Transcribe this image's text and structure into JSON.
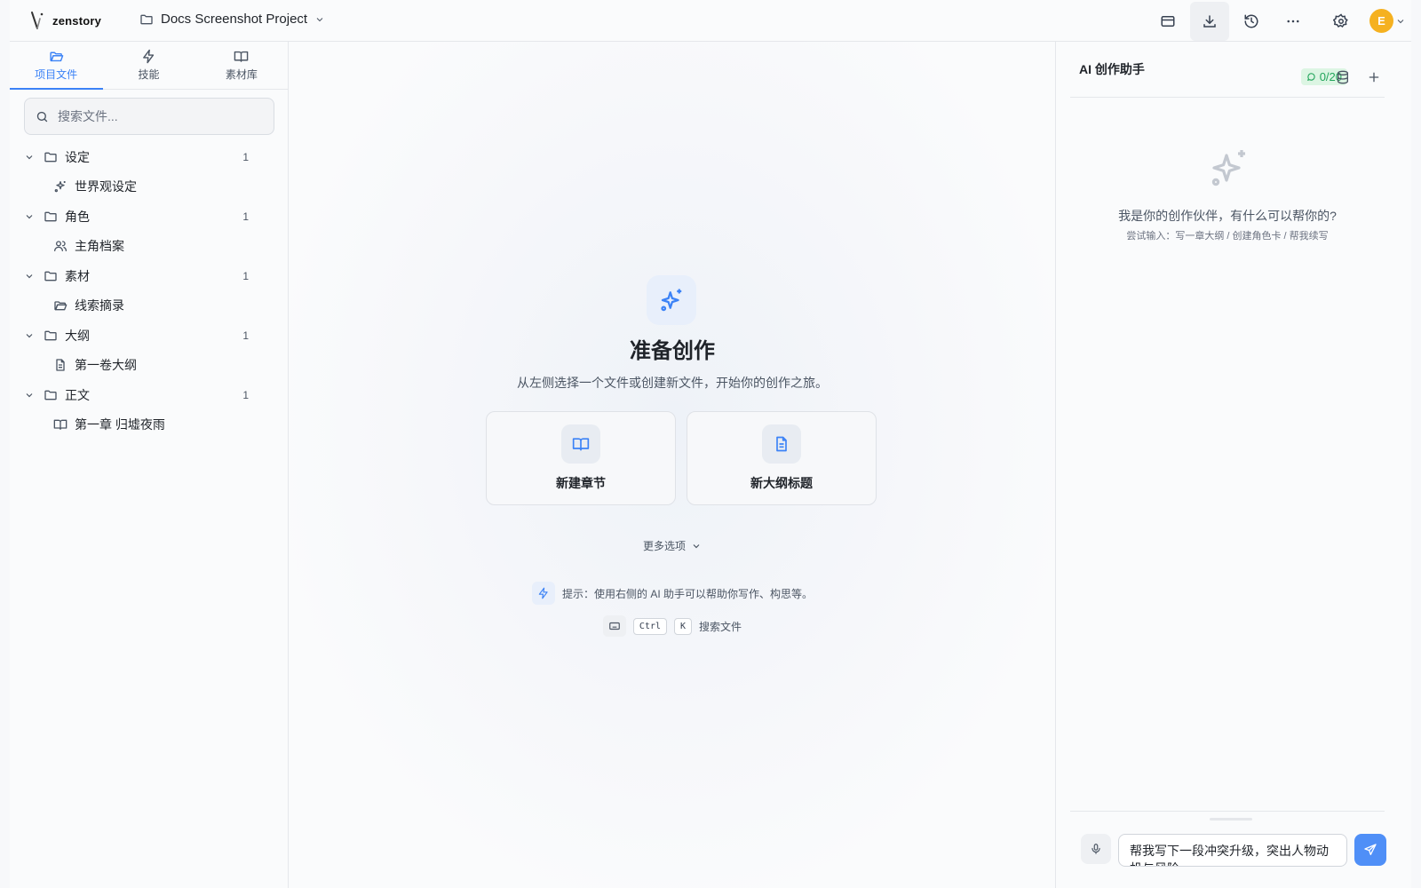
{
  "app": {
    "logo_text": "zenstory",
    "project_name": "Docs Screenshot Project"
  },
  "topbar": {
    "icons": [
      "window-icon",
      "download-icon",
      "history-icon",
      "more-icon",
      "settings-icon"
    ],
    "avatar_initial": "E"
  },
  "sidebar": {
    "tabs": [
      {
        "label": "项目文件",
        "icon": "folder-open-icon"
      },
      {
        "label": "技能",
        "icon": "lightning-icon"
      },
      {
        "label": "素材库",
        "icon": "book-icon"
      }
    ],
    "search_placeholder": "搜索文件...",
    "folders": [
      {
        "label": "设定",
        "count": "1",
        "files": [
          {
            "label": "世界观设定",
            "icon": "sparkle-icon"
          }
        ]
      },
      {
        "label": "角色",
        "count": "1",
        "files": [
          {
            "label": "主角档案",
            "icon": "users-icon"
          }
        ]
      },
      {
        "label": "素材",
        "count": "1",
        "files": [
          {
            "label": "线索摘录",
            "icon": "folder-open-icon"
          }
        ]
      },
      {
        "label": "大纲",
        "count": "1",
        "files": [
          {
            "label": "第一卷大纲",
            "icon": "document-icon"
          }
        ]
      },
      {
        "label": "正文",
        "count": "1",
        "files": [
          {
            "label": "第一章 归墟夜雨",
            "icon": "book-icon"
          }
        ]
      }
    ]
  },
  "main": {
    "title": "准备创作",
    "subtitle": "从左侧选择一个文件或创建新文件，开始你的创作之旅。",
    "cards": [
      {
        "label": "新建章节",
        "icon": "book-icon"
      },
      {
        "label": "新大纲标题",
        "icon": "document-icon"
      }
    ],
    "more_label": "更多选项",
    "tip": "提示：使用右侧的 AI 助手可以帮助你写作、构思等。",
    "shortcut": {
      "key1": "Ctrl",
      "key2": "K",
      "label": "搜索文件"
    }
  },
  "assistant": {
    "title": "AI 创作助手",
    "quota": "0/20",
    "empty_title": "我是你的创作伙伴，有什么可以帮你的?",
    "empty_sub": "尝试输入：写一章大纲 / 创建角色卡 / 帮我续写",
    "input_value": "帮我写下一段冲突升级，突出人物动机与风险"
  },
  "colors": {
    "accent": "#3b82f6",
    "send": "#4f8ff7",
    "avatar": "#f5b120",
    "quota_bg": "#dcf5e3",
    "quota_text": "#22a55b"
  }
}
